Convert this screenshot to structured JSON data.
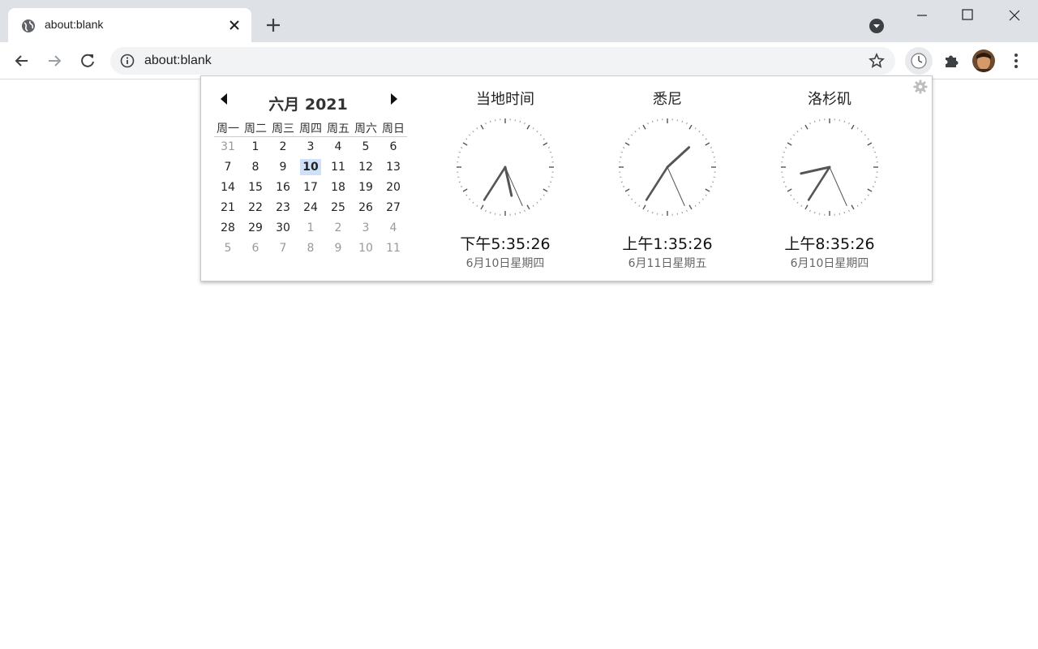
{
  "tab": {
    "title": "about:blank"
  },
  "omnibox": {
    "url": "about:blank"
  },
  "calendar": {
    "title": "六月 2021",
    "weekdays": [
      "周一",
      "周二",
      "周三",
      "周四",
      "周五",
      "周六",
      "周日"
    ],
    "weeks": [
      [
        {
          "d": "31",
          "other": true
        },
        {
          "d": "1"
        },
        {
          "d": "2"
        },
        {
          "d": "3"
        },
        {
          "d": "4"
        },
        {
          "d": "5"
        },
        {
          "d": "6"
        }
      ],
      [
        {
          "d": "7"
        },
        {
          "d": "8"
        },
        {
          "d": "9"
        },
        {
          "d": "10",
          "today": true
        },
        {
          "d": "11"
        },
        {
          "d": "12"
        },
        {
          "d": "13"
        }
      ],
      [
        {
          "d": "14"
        },
        {
          "d": "15"
        },
        {
          "d": "16"
        },
        {
          "d": "17"
        },
        {
          "d": "18"
        },
        {
          "d": "19"
        },
        {
          "d": "20"
        }
      ],
      [
        {
          "d": "21"
        },
        {
          "d": "22"
        },
        {
          "d": "23"
        },
        {
          "d": "24"
        },
        {
          "d": "25"
        },
        {
          "d": "26"
        },
        {
          "d": "27"
        }
      ],
      [
        {
          "d": "28"
        },
        {
          "d": "29"
        },
        {
          "d": "30"
        },
        {
          "d": "1",
          "other": true
        },
        {
          "d": "2",
          "other": true
        },
        {
          "d": "3",
          "other": true
        },
        {
          "d": "4",
          "other": true
        }
      ],
      [
        {
          "d": "5",
          "other": true
        },
        {
          "d": "6",
          "other": true
        },
        {
          "d": "7",
          "other": true
        },
        {
          "d": "8",
          "other": true
        },
        {
          "d": "9",
          "other": true
        },
        {
          "d": "10",
          "other": true
        },
        {
          "d": "11",
          "other": true
        }
      ]
    ]
  },
  "clocks": [
    {
      "name": "当地时间",
      "time": "下午5:35:26",
      "date": "6月10日星期四",
      "hour": 5,
      "minute": 35,
      "second": 26
    },
    {
      "name": "悉尼",
      "time": "上午1:35:26",
      "date": "6月11日星期五",
      "hour": 1,
      "minute": 35,
      "second": 26
    },
    {
      "name": "洛杉矶",
      "time": "上午8:35:26",
      "date": "6月10日星期四",
      "hour": 8,
      "minute": 35,
      "second": 26
    }
  ],
  "colors": {
    "tabstrip": "#dee1e6",
    "today_highlight": "#cfe1f7",
    "clock_hand": "#555555"
  }
}
